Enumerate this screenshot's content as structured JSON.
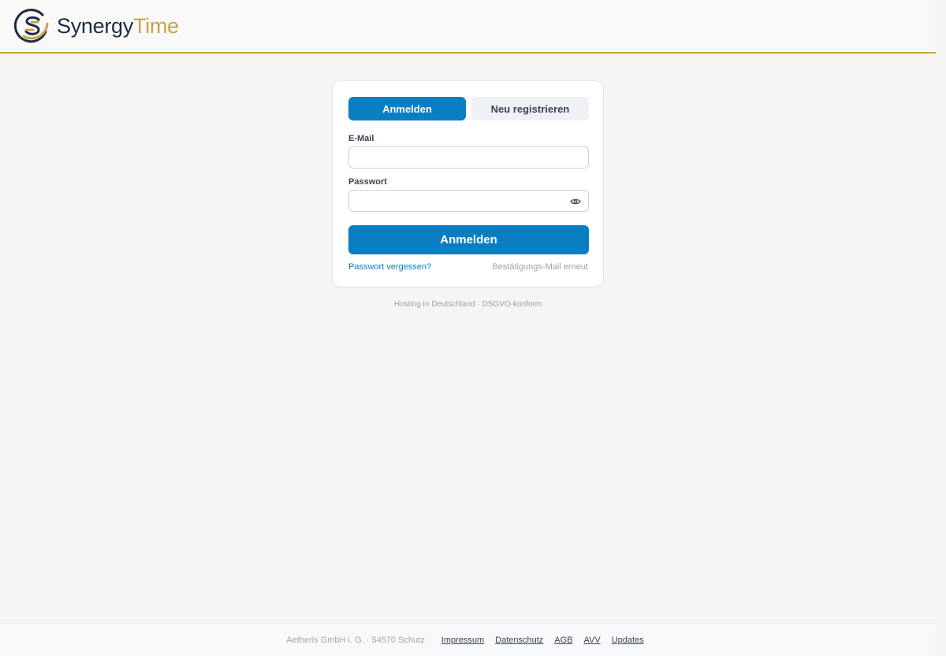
{
  "header": {
    "brand_part1": "Synergy",
    "brand_part2": "Time",
    "logo_icon": "synergytime-logo-icon",
    "accent_color": "#c9a43c"
  },
  "login_card": {
    "tabs": [
      {
        "label": "Anmelden",
        "active": true
      },
      {
        "label": "Neu registrieren",
        "active": false
      }
    ],
    "email_label": "E-Mail",
    "email_value": "",
    "password_label": "Passwort",
    "password_value": "",
    "password_toggle_icon": "eye-icon",
    "submit_label": "Anmelden",
    "forgot_link": "Passwort vergessen?",
    "resend_link": "Bestätigungs-Mail erneut",
    "primary_color": "#0a7ec2"
  },
  "hosting_note": "Hosting in Deutschland · DSGVO-konform",
  "footer": {
    "company": "Aetheris GmbH i. G. · 54570 Schutz",
    "links": [
      "Impressum",
      "Datenschutz",
      "AGB",
      "AVV",
      "Updates"
    ]
  }
}
